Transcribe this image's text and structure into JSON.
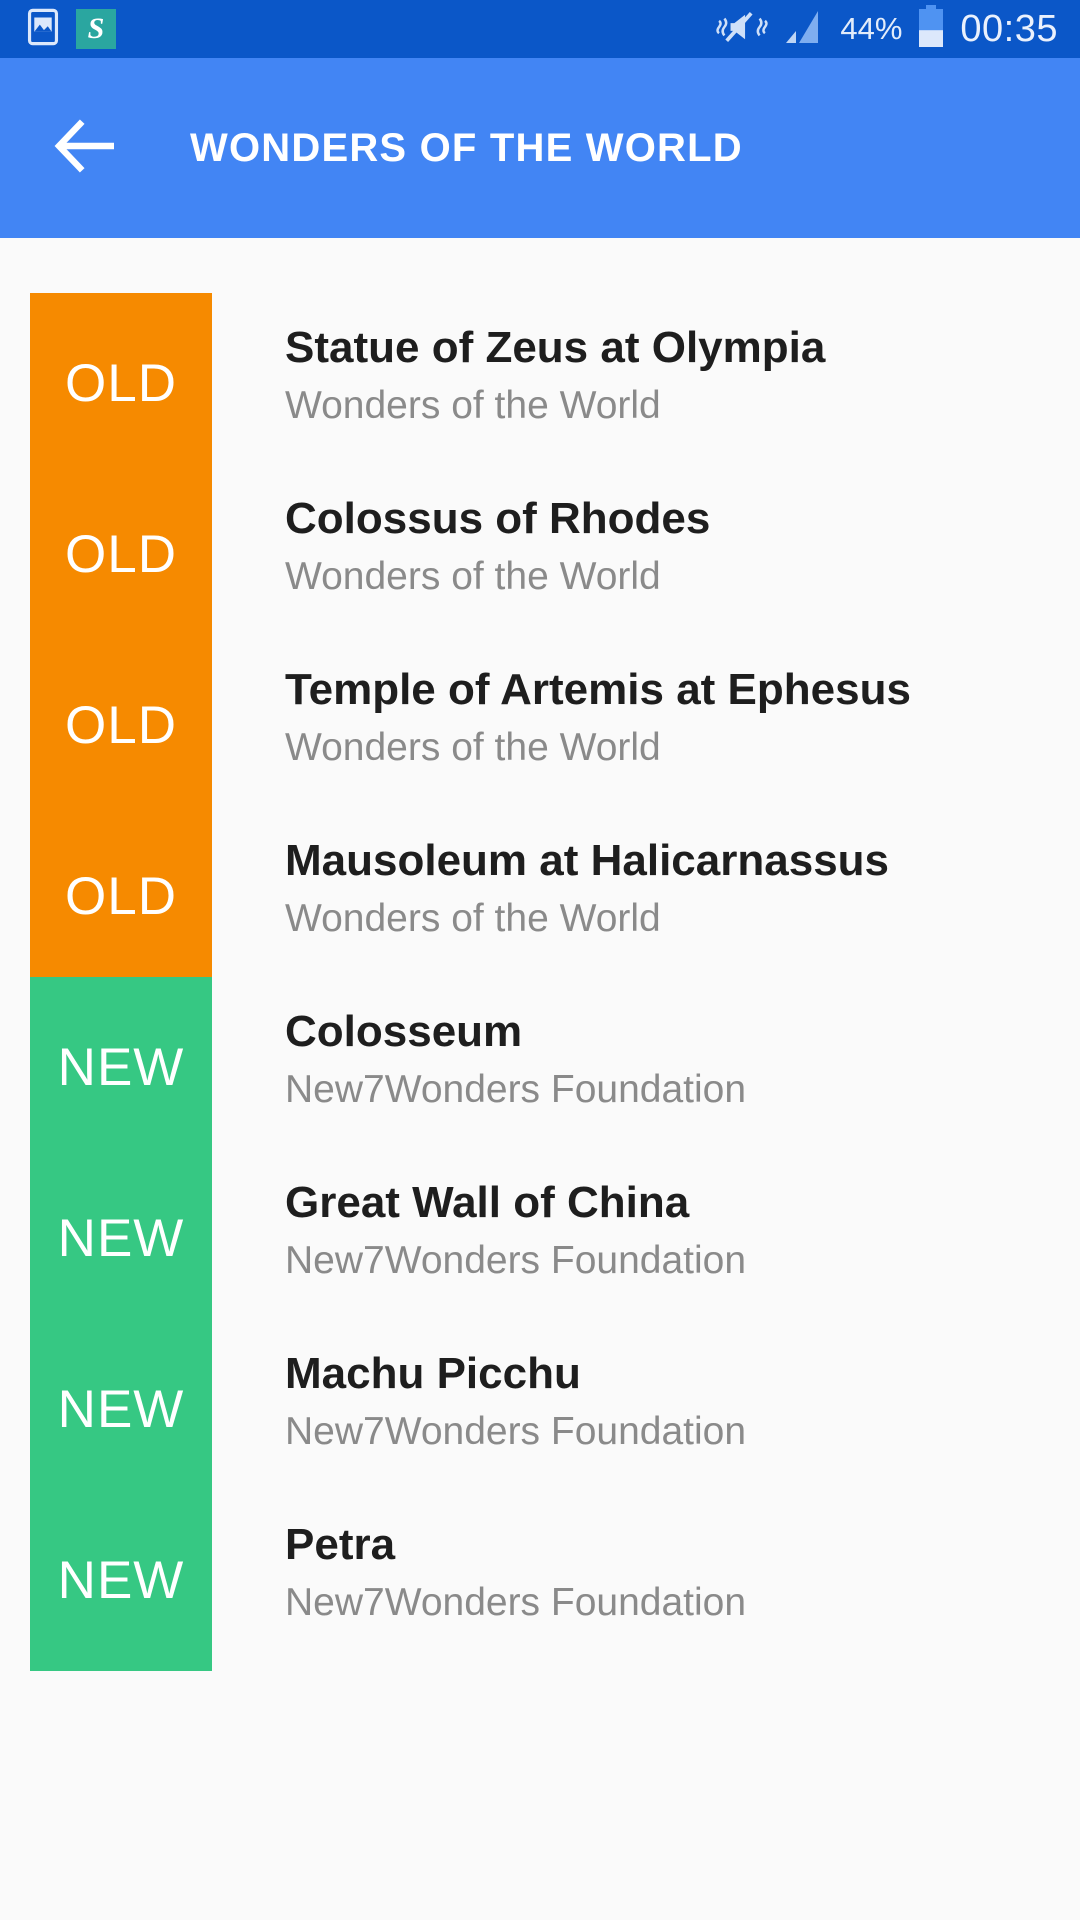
{
  "status_bar": {
    "icons": [
      "image-notification-icon",
      "app-s-icon"
    ],
    "app_badge_letter": "S",
    "vibrate_mute_icon": "vibrate-mute-icon",
    "signal_icon": "signal-bars-icon",
    "battery_percent": "44%",
    "battery_icon": "battery-icon",
    "clock": "00:35"
  },
  "app_bar": {
    "back_icon": "back-arrow-icon",
    "title": "WONDERS OF THE WORLD"
  },
  "colors": {
    "status_bar_bg": "#0B57C8",
    "app_bar_bg": "#4285F4",
    "list_bg": "#FAFAFA",
    "badge_old": "#F68A00",
    "badge_new": "#36C883",
    "title_text": "#1E1E1E",
    "subtitle_text": "#8A8A8A",
    "app_icon_teal": "#2AA6A0"
  },
  "list": {
    "items": [
      {
        "badge": "OLD",
        "type": "old",
        "title": "Statue of Zeus at Olympia",
        "subtitle": "Wonders of the World"
      },
      {
        "badge": "OLD",
        "type": "old",
        "title": "Colossus of Rhodes",
        "subtitle": "Wonders of the World"
      },
      {
        "badge": "OLD",
        "type": "old",
        "title": "Temple of Artemis at Ephesus",
        "subtitle": "Wonders of the World"
      },
      {
        "badge": "OLD",
        "type": "old",
        "title": "Mausoleum at Halicarnassus",
        "subtitle": "Wonders of the World"
      },
      {
        "badge": "NEW",
        "type": "new",
        "title": "Colosseum",
        "subtitle": "New7Wonders Foundation"
      },
      {
        "badge": "NEW",
        "type": "new",
        "title": "Great Wall of China",
        "subtitle": "New7Wonders Foundation"
      },
      {
        "badge": "NEW",
        "type": "new",
        "title": "Machu Picchu",
        "subtitle": "New7Wonders Foundation"
      },
      {
        "badge": "NEW",
        "type": "new",
        "title": "Petra",
        "subtitle": "New7Wonders Foundation"
      }
    ]
  }
}
